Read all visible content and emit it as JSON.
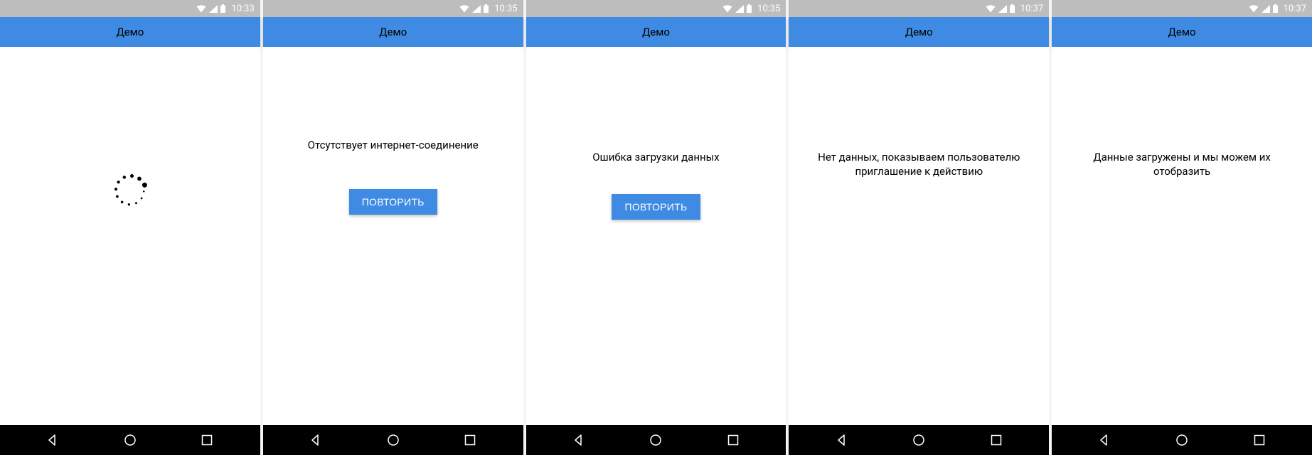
{
  "screens": [
    {
      "status_time": "10:33",
      "app_title": "Демо",
      "kind": "loading"
    },
    {
      "status_time": "10:35",
      "app_title": "Демо",
      "kind": "message_with_button",
      "message": "Отсутствует интернет-соединение",
      "button_label": "ПОВТОРИТЬ"
    },
    {
      "status_time": "10:35",
      "app_title": "Демо",
      "kind": "message_with_button",
      "message": "Ошибка загрузки данных",
      "button_label": "ПОВТОРИТЬ"
    },
    {
      "status_time": "10:37",
      "app_title": "Демо",
      "kind": "message_only",
      "message": "Нет данных, показываем пользователю приглашение к действию"
    },
    {
      "status_time": "10:37",
      "app_title": "Демо",
      "kind": "message_only",
      "message": "Данные загружены и мы можем их отобразить"
    }
  ]
}
